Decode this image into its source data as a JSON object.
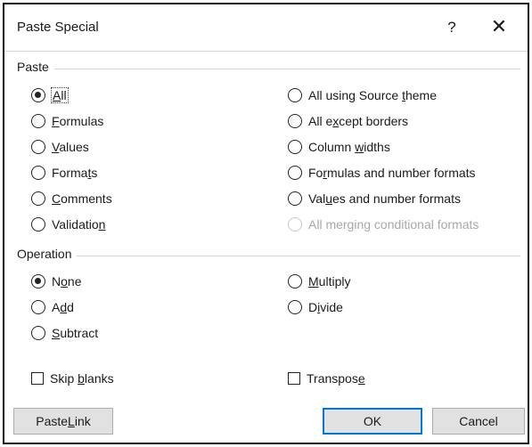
{
  "window": {
    "title": "Paste Special",
    "help_glyph": "?",
    "close_glyph": "✕"
  },
  "paste": {
    "label": "Paste",
    "left_options": [
      {
        "pre": "",
        "ul": "A",
        "post": "ll",
        "checked": true,
        "disabled": false,
        "focused": true
      },
      {
        "pre": "",
        "ul": "F",
        "post": "ormulas",
        "checked": false,
        "disabled": false,
        "focused": false
      },
      {
        "pre": "",
        "ul": "V",
        "post": "alues",
        "checked": false,
        "disabled": false,
        "focused": false
      },
      {
        "pre": "Forma",
        "ul": "t",
        "post": "s",
        "checked": false,
        "disabled": false,
        "focused": false
      },
      {
        "pre": "",
        "ul": "C",
        "post": "omments",
        "checked": false,
        "disabled": false,
        "focused": false
      },
      {
        "pre": "Validatio",
        "ul": "n",
        "post": "",
        "checked": false,
        "disabled": false,
        "focused": false
      }
    ],
    "right_options": [
      {
        "pre": "All using Source ",
        "ul": "t",
        "post": "heme",
        "checked": false,
        "disabled": false
      },
      {
        "pre": "All e",
        "ul": "x",
        "post": "cept borders",
        "checked": false,
        "disabled": false
      },
      {
        "pre": "Column ",
        "ul": "w",
        "post": "idths",
        "checked": false,
        "disabled": false
      },
      {
        "pre": "Fo",
        "ul": "r",
        "post": "mulas and number formats",
        "checked": false,
        "disabled": false
      },
      {
        "pre": "Val",
        "ul": "u",
        "post": "es and number formats",
        "checked": false,
        "disabled": false
      },
      {
        "pre": "All merging conditional formats",
        "ul": "",
        "post": "",
        "checked": false,
        "disabled": true
      }
    ]
  },
  "operation": {
    "label": "Operation",
    "left_options": [
      {
        "pre": "N",
        "ul": "o",
        "post": "ne",
        "checked": true
      },
      {
        "pre": "A",
        "ul": "d",
        "post": "d",
        "checked": false
      },
      {
        "pre": "",
        "ul": "S",
        "post": "ubtract",
        "checked": false
      }
    ],
    "right_options": [
      {
        "pre": "",
        "ul": "M",
        "post": "ultiply",
        "checked": false
      },
      {
        "pre": "D",
        "ul": "i",
        "post": "vide",
        "checked": false
      }
    ]
  },
  "checkboxes": {
    "skip_blanks": {
      "pre": "Skip ",
      "ul": "b",
      "post": "lanks",
      "checked": false
    },
    "transpose": {
      "pre": "Transpos",
      "ul": "e",
      "post": "",
      "checked": false
    }
  },
  "buttons": {
    "paste_link": {
      "pre": "Paste ",
      "ul": "L",
      "post": "ink"
    },
    "ok": "OK",
    "cancel": "Cancel"
  }
}
